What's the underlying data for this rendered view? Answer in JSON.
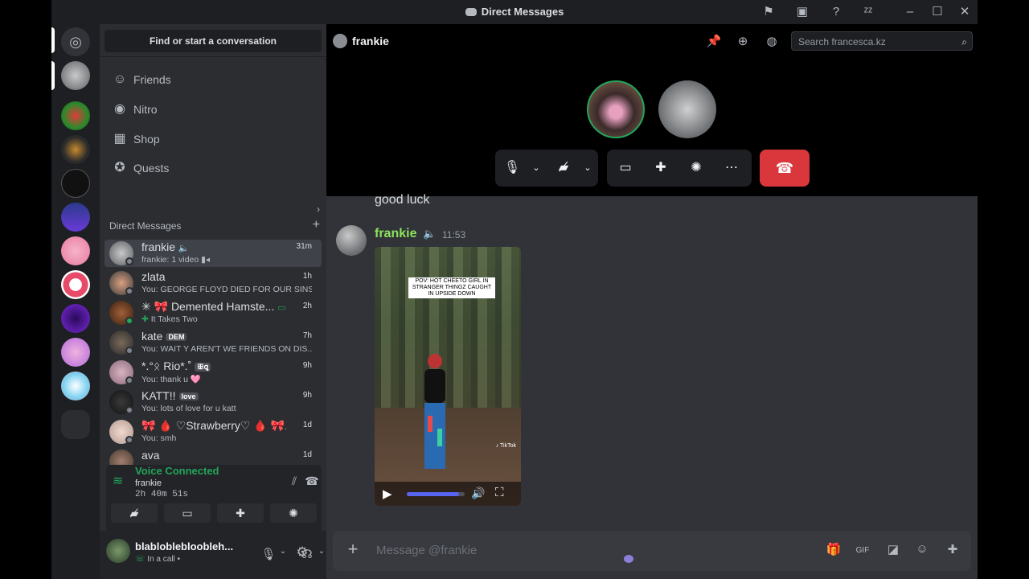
{
  "window": {
    "title": "Direct Messages"
  },
  "sidebar": {
    "find_label": "Find or start a conversation",
    "nav": [
      {
        "label": "Friends",
        "icon": "friends-icon"
      },
      {
        "label": "Nitro",
        "icon": "nitro-icon"
      },
      {
        "label": "Shop",
        "icon": "shop-icon"
      },
      {
        "label": "Quests",
        "icon": "quests-icon"
      }
    ],
    "dm_header": "Direct Messages",
    "dms": [
      {
        "name": "frankie",
        "sub": "frankie: 1 video",
        "time": "31m"
      },
      {
        "name": "zlata",
        "sub": "You: GEORGE FLOYD DIED FOR OUR SINS",
        "time": "1h"
      },
      {
        "name": "✳ 🎀 Demented Hamste...",
        "sub": "It Takes Two",
        "time": "2h"
      },
      {
        "name": "kate",
        "tag": "DEM",
        "sub": "You: WAIT Y AREN'T WE FRIENDS ON DIS...",
        "time": "7h"
      },
      {
        "name": "*.°ᛟ Rio*.˚",
        "tag": "ꕥꝗ",
        "sub": "You: thank u 🩷",
        "time": "9h"
      },
      {
        "name": "KATT!!",
        "tag": "love",
        "sub": "You: lots of love for u katt",
        "time": "9h"
      },
      {
        "name": "🎀 🩸 ♡Strawberry♡ 🩸 🎀...",
        "sub": "You: smh",
        "time": "1d"
      },
      {
        "name": "ava",
        "sub": "",
        "time": "1d"
      }
    ]
  },
  "voice": {
    "status": "Voice Connected",
    "channel": "frankie",
    "timer": "2h 40m 51s"
  },
  "user": {
    "name": "blabloblebloobleh...",
    "status": "In a call •"
  },
  "header": {
    "channel": "frankie",
    "search_placeholder": "Search francesca.kz"
  },
  "messages": {
    "prev_text": "good luck",
    "author": "frankie",
    "time": "11:53",
    "video_caption": "POV: HOT CHEETO GIRL IN STRANGER THINGZ CAUGHT IN UPSIDE DOWN",
    "video_watermark": "TikTok",
    "video_progress": 0.9
  },
  "composer": {
    "placeholder": "Message @frankie"
  },
  "colors": {
    "accent": "#5865f2",
    "online": "#23a55a",
    "danger": "#da373c",
    "author": "#8ee35d"
  }
}
